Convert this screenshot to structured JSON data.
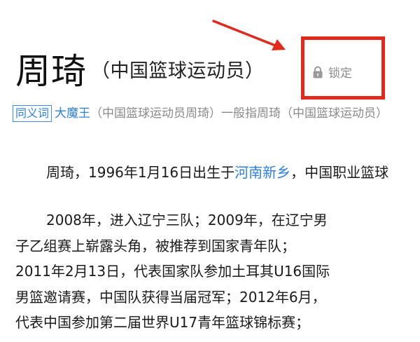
{
  "header": {
    "title": "周琦",
    "subtitle": "（中国篮球运动员）",
    "lock_label": "锁定",
    "lock_icon": "lock-icon"
  },
  "synonym": {
    "tag": "同义词",
    "link": "大魔王",
    "desc": "（中国篮球运动员周琦）一般指周琦（中国篮球运动员）"
  },
  "intro": {
    "before": "周琦，1996年1月16日出生于",
    "link": "河南新乡",
    "after": "，中国职业篮球"
  },
  "career": {
    "lines": [
      "2008年，进入辽宁三队；2009年，在辽宁男",
      "子乙组赛上崭露头角，被推荐到国家青年队；",
      "2011年2月13日，代表国家队参加土耳其U16国际",
      "男篮邀请赛，中国队获得当届冠军；2012年6月，",
      "代表中国参加第二届世界U17青年篮球锦标赛；"
    ]
  },
  "colors": {
    "accent": "#2f7fdc",
    "highlight": "#e02a1e",
    "muted": "#8a8a8a"
  }
}
